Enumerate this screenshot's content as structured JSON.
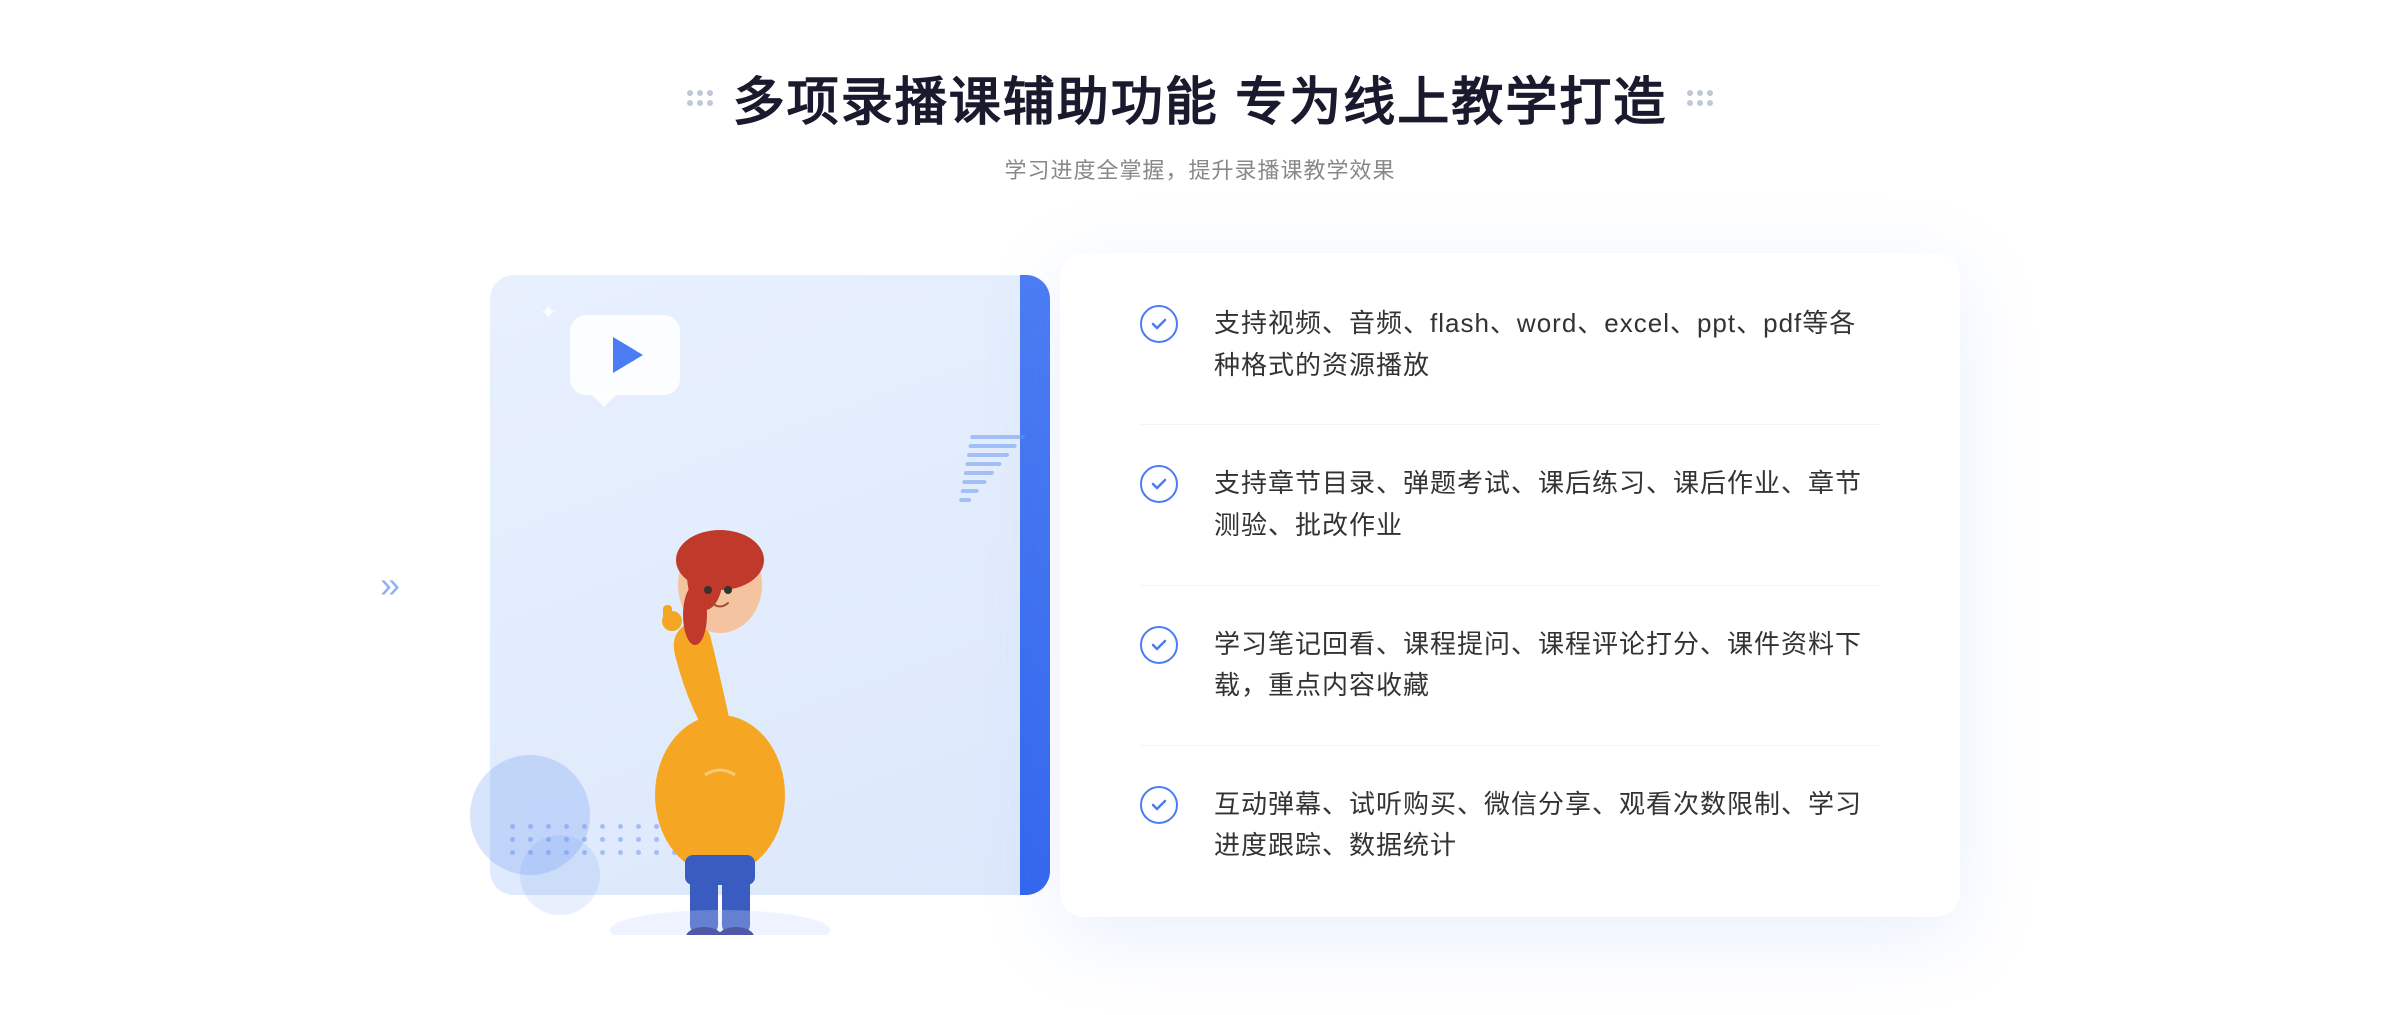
{
  "header": {
    "main_title": "多项录播课辅助功能 专为线上教学打造",
    "sub_title": "学习进度全掌握，提升录播课教学效果"
  },
  "features": [
    {
      "id": 1,
      "text": "支持视频、音频、flash、word、excel、ppt、pdf等各种格式的资源播放"
    },
    {
      "id": 2,
      "text": "支持章节目录、弹题考试、课后练习、课后作业、章节测验、批改作业"
    },
    {
      "id": 3,
      "text": "学习笔记回看、课程提问、课程评论打分、课件资料下载，重点内容收藏"
    },
    {
      "id": 4,
      "text": "互动弹幕、试听购买、微信分享、观看次数限制、学习进度跟踪、数据统计"
    }
  ],
  "decorations": {
    "left_arrows": "»",
    "sparkle": "✦"
  },
  "colors": {
    "primary_blue": "#4b7cf3",
    "light_blue_bg": "#e8f0fe",
    "text_dark": "#1a1a2e",
    "text_gray": "#888",
    "text_feature": "#333"
  }
}
